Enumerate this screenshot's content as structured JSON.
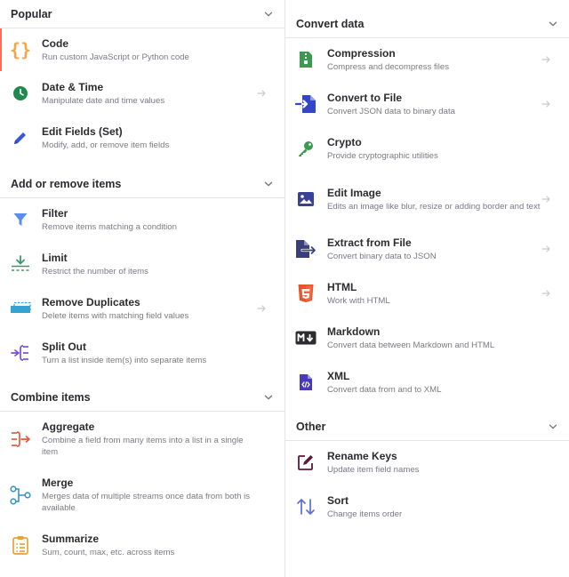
{
  "left": {
    "sections": [
      {
        "title": "Popular",
        "items": [
          {
            "title": "Code",
            "desc": "Run custom JavaScript or Python code",
            "icon": "code-braces-icon",
            "active": true
          },
          {
            "title": "Date & Time",
            "desc": "Manipulate date and time values",
            "icon": "clock-icon",
            "arrow": true
          },
          {
            "title": "Edit Fields (Set)",
            "desc": "Modify, add, or remove item fields",
            "icon": "pen-icon"
          }
        ]
      },
      {
        "title": "Add or remove items",
        "items": [
          {
            "title": "Filter",
            "desc": "Remove items matching a condition",
            "icon": "filter-icon"
          },
          {
            "title": "Limit",
            "desc": "Restrict the number of items",
            "icon": "limit-icon"
          },
          {
            "title": "Remove Duplicates",
            "desc": "Delete items with matching field values",
            "icon": "remove-duplicates-icon",
            "arrow": true
          },
          {
            "title": "Split Out",
            "desc": "Turn a list inside item(s) into separate items",
            "icon": "split-out-icon"
          }
        ]
      },
      {
        "title": "Combine items",
        "items": [
          {
            "title": "Aggregate",
            "desc": "Combine a field from many items into a list in a single item",
            "icon": "aggregate-icon"
          },
          {
            "title": "Merge",
            "desc": "Merges data of multiple streams once data from both is available",
            "icon": "merge-icon"
          },
          {
            "title": "Summarize",
            "desc": "Sum, count, max, etc. across items",
            "icon": "summarize-icon"
          }
        ]
      }
    ]
  },
  "right": {
    "sections": [
      {
        "title": "Convert data",
        "items": [
          {
            "title": "Compression",
            "desc": "Compress and decompress files",
            "icon": "compression-icon",
            "arrow": true
          },
          {
            "title": "Convert to File",
            "desc": "Convert JSON data to binary data",
            "icon": "convert-to-file-icon",
            "arrow": true
          },
          {
            "title": "Crypto",
            "desc": "Provide cryptographic utilities",
            "icon": "key-icon"
          },
          {
            "title": "Edit Image",
            "desc": "Edits an image like blur, resize or adding border and text",
            "icon": "image-icon",
            "arrow": true
          },
          {
            "title": "Extract from File",
            "desc": "Convert binary data to JSON",
            "icon": "extract-from-file-icon",
            "arrow": true
          },
          {
            "title": "HTML",
            "desc": "Work with HTML",
            "icon": "html5-icon",
            "arrow": true
          },
          {
            "title": "Markdown",
            "desc": "Convert data between Markdown and HTML",
            "icon": "markdown-icon"
          },
          {
            "title": "XML",
            "desc": "Convert data from and to XML",
            "icon": "xml-file-icon"
          }
        ]
      },
      {
        "title": "Other",
        "items": [
          {
            "title": "Rename Keys",
            "desc": "Update item field names",
            "icon": "rename-icon"
          },
          {
            "title": "Sort",
            "desc": "Change items order",
            "icon": "sort-icon"
          }
        ]
      }
    ]
  }
}
